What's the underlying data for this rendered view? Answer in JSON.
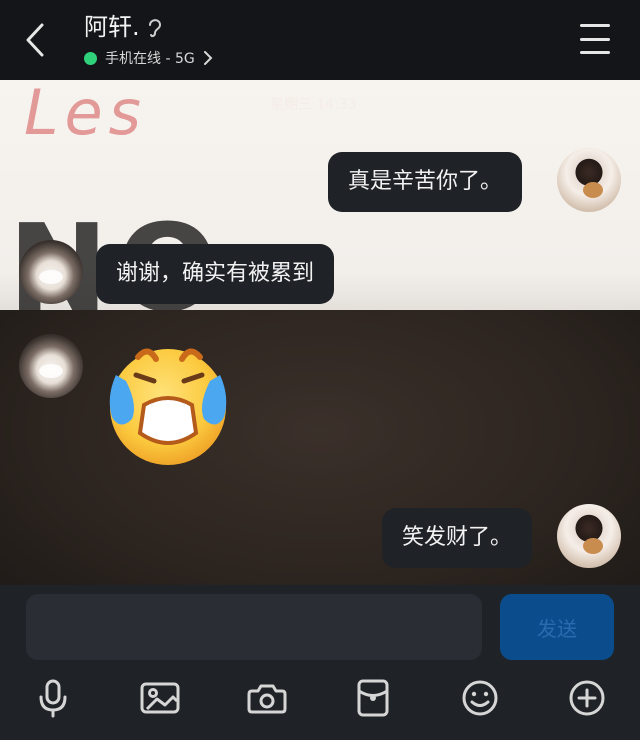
{
  "header": {
    "contact_name": "阿轩.",
    "status_text": "手机在线 - 5G",
    "status_color": "#2fd27a",
    "icons": [
      "back-arrow-icon",
      "ear-icon",
      "chevron-right-icon",
      "menu-icon"
    ]
  },
  "chat": {
    "timestamp": "星期三 14:33",
    "messages": [
      {
        "side": "right",
        "sender": "me",
        "text": "真是辛苦你了。"
      },
      {
        "side": "left",
        "sender": "阿轩.",
        "text": "谢谢，确实有被累到"
      },
      {
        "side": "left",
        "sender": "阿轩.",
        "sticker": "crying-face-emoji"
      },
      {
        "side": "right",
        "sender": "me",
        "text": "笑发财了。"
      }
    ]
  },
  "input": {
    "placeholder": "",
    "value": "",
    "send_label": "发送"
  },
  "toolbar": {
    "items": [
      "mic-icon",
      "image-icon",
      "camera-icon",
      "red-packet-icon",
      "emoji-icon",
      "plus-icon"
    ]
  },
  "colors": {
    "header_bg": "#141518",
    "bubble_bg": "#1f2226",
    "send_bg": "#0b4d8c",
    "send_text": "#2a6bb0"
  }
}
